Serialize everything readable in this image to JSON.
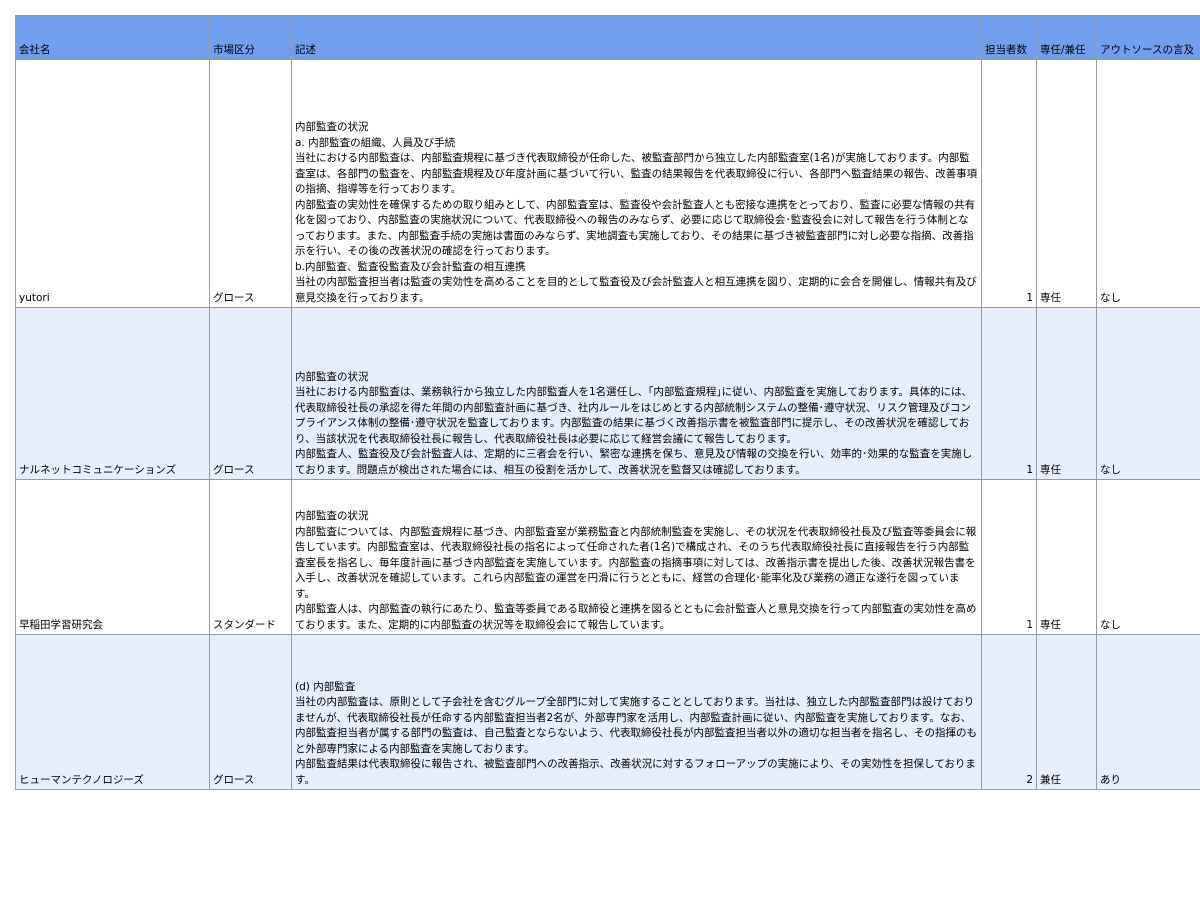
{
  "table": {
    "headers": {
      "company": "会社名",
      "market": "市場区分",
      "description": "記述",
      "staff_count": "担当者数",
      "fulltime": "専任/兼任",
      "outsource": "アウトソースの言及"
    },
    "rows": [
      {
        "company": "yutori",
        "market": "グロース",
        "description": "内部監査の状況\na. 内部監査の組織、人員及び手続\n当社における内部監査は、内部監査規程に基づき代表取締役が任命した、被監査部門から独立した内部監査室(1名)が実施しております。内部監査室は、各部門の監査を、内部監査規程及び年度計画に基づいて行い、監査の結果報告を代表取締役に行い、各部門へ監査結果の報告、改善事項の指摘、指導等を行っております。\n内部監査の実効性を確保するための取り組みとして、内部監査室は、監査役や会計監査人とも密接な連携をとっており、監査に必要な情報の共有化を図っており、内部監査の実施状況について、代表取締役への報告のみならず、必要に応じて取締役会･監査役会に対して報告を行う体制となっております。また、内部監査手続の実施は書面のみならず、実地調査も実施しており、その結果に基づき被監査部門に対し必要な指摘、改善指示を行い、その後の改善状況の確認を行っております。\nb.内部監査、監査役監査及び会計監査の相互連携\n当社の内部監査担当者は監査の実効性を高めることを目的として監査役及び会計監査人と相互連携を図り、定期的に会合を開催し、情報共有及び意見交換を行っております。",
        "staff_count": "1",
        "fulltime": "専任",
        "outsource": "なし"
      },
      {
        "company": "ナルネットコミュニケーションズ",
        "market": "グロース",
        "description": "内部監査の状況\n当社における内部監査は、業務執行から独立した内部監査人を1名選任し、｢内部監査規程｣に従い、内部監査を実施しております。具体的には、代表取締役社長の承認を得た年間の内部監査計画に基づき、社内ルールをはじめとする内部統制システムの整備･遵守状況、リスク管理及びコンプライアンス体制の整備･遵守状況を監査しております。内部監査の結果に基づく改善指示書を被監査部門に提示し、その改善状況を確認しており、当該状況を代表取締役社長に報告し、代表取締役社長は必要に応じて経営会議にて報告しております。\n内部監査人、監査役及び会計監査人は、定期的に三者会を行い、緊密な連携を保ち、意見及び情報の交換を行い、効率的･効果的な監査を実施しております。問題点が検出された場合には、相互の役割を活かして、改善状況を監督又は確認しております。",
        "staff_count": "1",
        "fulltime": "専任",
        "outsource": "なし"
      },
      {
        "company": "早稲田学習研究会",
        "market": "スタンダード",
        "description": "内部監査の状況\n内部監査については、内部監査規程に基づき、内部監査室が業務監査と内部統制監査を実施し、その状況を代表取締役社長及び監査等委員会に報告しています。内部監査室は、代表取締役社長の指名によって任命された者(1名)で構成され、そのうち代表取締役社長に直接報告を行う内部監査室長を指名し、毎年度計画に基づき内部監査を実施しています。内部監査の指摘事項に対しては、改善指示書を提出した後、改善状況報告書を入手し、改善状況を確認しています。これら内部監査の運営を円滑に行うとともに、経営の合理化･能率化及び業務の適正な遂行を図っています。\n内部監査人は、内部監査の執行にあたり、監査等委員である取締役と連携を図るとともに会計監査人と意見交換を行って内部監査の実効性を高めております。また、定期的に内部監査の状況等を取締役会にて報告しています。",
        "staff_count": "1",
        "fulltime": "専任",
        "outsource": "なし"
      },
      {
        "company": "ヒューマンテクノロジーズ",
        "market": "グロース",
        "description": "(d) 内部監査\n当社の内部監査は、原則として子会社を含むグループ全部門に対して実施することとしております。当社は、独立した内部監査部門は設けておりませんが、代表取締役社長が任命する内部監査担当者2名が、外部専門家を活用し、内部監査計画に従い、内部監査を実施しております。なお、内部監査担当者が属する部門の監査は、自己監査とならないよう、代表取締役社長が内部監査担当者以外の適切な担当者を指名し、その指揮のもと外部専門家による内部監査を実施しております。\n内部監査結果は代表取締役に報告され、被監査部門への改善指示、改善状況に対するフォローアップの実施により、その実効性を担保しております。",
        "staff_count": "2",
        "fulltime": "兼任",
        "outsource": "あり"
      }
    ]
  }
}
